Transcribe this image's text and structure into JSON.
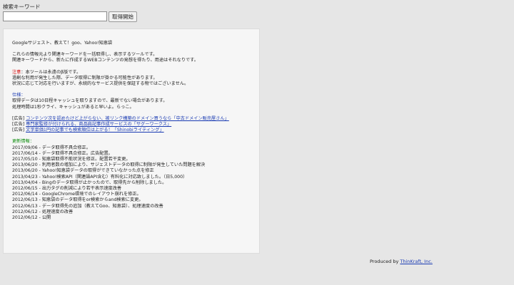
{
  "search": {
    "label": "検索キーワード",
    "value": "",
    "placeholder": "",
    "button_label": "取得開始"
  },
  "panel": {
    "title": "Googleサジェスト、教えて！goo、Yahoo!知恵袋",
    "intro": [
      "これらの情報元より関連キーワードを一括取得し、表示するツールです。",
      "関連キーワードから、新たに作成するWEBコンテンツの発想を得たり、用途はそれなりです。"
    ],
    "notice": {
      "label": "注意",
      "first": "：本ツールは永遠のβ版です。",
      "lines": [
        "過剰な利用が発生した際、データ取得に制限が掛かる可能性があります。",
        "状況に応じて対応を行いますが、永続的なサービス提供を保証する物ではございません。"
      ]
    },
    "spec": {
      "label": "仕様：",
      "lines": [
        "取得データは10日程キャッシュを取りますので、最新でない場合があります。",
        "処理時間は1秒クライ、キャッシュがあると早いよ。らっこ。"
      ]
    },
    "ads": [
      {
        "prefix": "[広告] ",
        "text": "コンテンツ次を認めたけど上がらない、被リンク構築のドメイン買うなら「中古ドメイン販売屋さん」"
      },
      {
        "prefix": "[広告] ",
        "text": "専門家監修が付けられる、商品肩記事作成サービスの「サグーワークス」"
      },
      {
        "prefix": "[広告] ",
        "text": "文字単価1円の記事でも検索順位は上がる！「Shinobiライティング」"
      }
    ],
    "updates": {
      "label": "更新情報：",
      "items": [
        "2017/09/06 - データ取得不具合修正。",
        "2017/06/14 - データ取得不具合修正。広告配置。",
        "2017/05/10 - 知恵袋取得不能状況を修正。配置若干変更。",
        "2013/06/20 - 利用者数の増加により、サジェストデータの取得に制限が発生していた問題を解決",
        "2013/06/20 - Yahoo!知恵袋データの取得ができていなかった点を修正",
        "2013/04/23 - Yahoo!検索API（関連語API含む）有料化に対応致しました。（日5,000）",
        "2013/04/04 - Bingのデータ取得が止かったので、取得先から削除しました。",
        "2012/06/15 - 出力タグの削減により若干表示速度改善",
        "2012/06/14 - GoogleChrome環境でのレイアウト崩れを修正。",
        "2012/06/13 - 知恵袋のデータ取得をor検索からand検索に変更。",
        "2012/06/13 - データ取得先の追加（教えてGoo、知恵袋）、処理速度の改善",
        "2012/06/12 - 処理速度の改善",
        "2012/06/12 - 公開"
      ]
    }
  },
  "footer": {
    "prefix": "Produced by ",
    "link": "ThinKraft, Inc."
  },
  "colors": {
    "notice": "#d00000",
    "spec": "#1a3bb3",
    "updates": "#0a8a0a",
    "link": "#1a3bb3",
    "background": "#e6e6e6",
    "panel": "#f6f6f6"
  }
}
